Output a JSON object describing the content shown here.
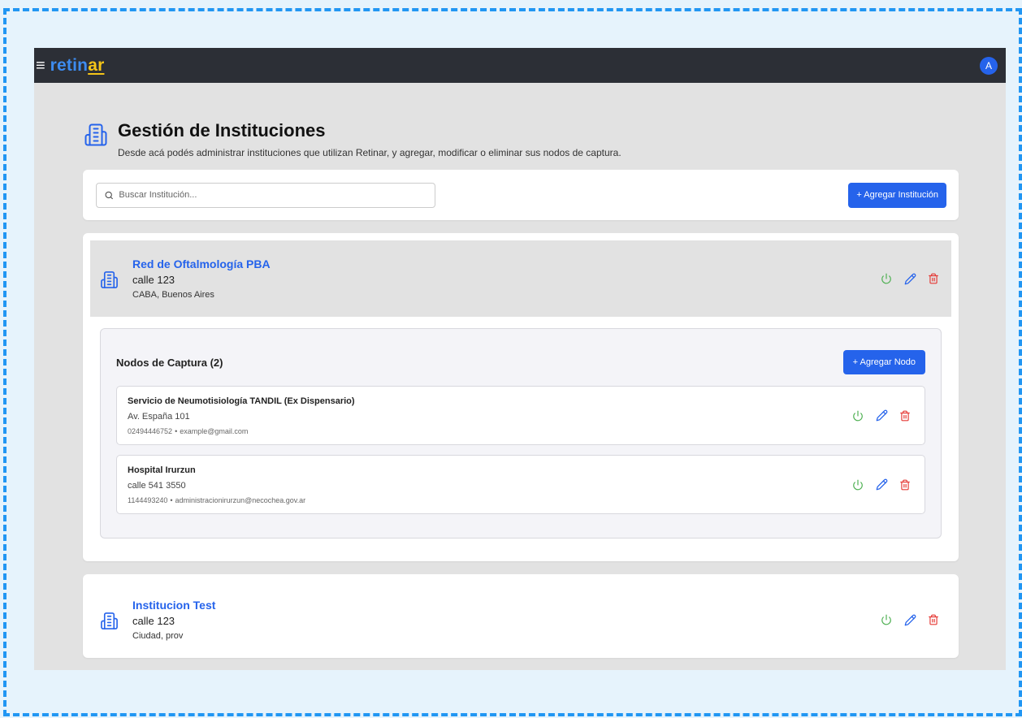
{
  "app": {
    "brand_part1": "retin",
    "brand_part2": "ar",
    "avatar_initial": "A"
  },
  "page": {
    "title": "Gestión de Instituciones",
    "subtitle": "Desde acá podés administrar instituciones que utilizan Retinar, y agregar, modificar o eliminar sus nodos de captura."
  },
  "search": {
    "placeholder": "Buscar Institución...",
    "add_button": "+ Agregar Institución"
  },
  "colors": {
    "accent": "#2563eb",
    "power": "#4caf50",
    "edit": "#2563eb",
    "delete": "#e53935",
    "topbar": "#2c2f36"
  },
  "institutions": [
    {
      "name": "Red de Oftalmología PBA",
      "street": "calle 123",
      "city": "CABA, Buenos Aires",
      "nodes": {
        "title": "Nodos de Captura (2)",
        "add_button": "+ Agregar Nodo",
        "items": [
          {
            "name": "Servicio de Neumotisiología TANDIL (Ex Dispensario)",
            "address": "Av. España 101",
            "phone": "02494446752",
            "separator": "•",
            "email": "example@gmail.com"
          },
          {
            "name": "Hospital Irurzun",
            "address": "calle 541 3550",
            "phone": "1144493240",
            "separator": "•",
            "email": "administracionirurzun@necochea.gov.ar"
          }
        ]
      }
    },
    {
      "name": "Institucion Test",
      "street": "calle 123",
      "city": "Ciudad, prov"
    }
  ],
  "icons": {
    "menu": "menu-icon",
    "building": "building-icon",
    "search": "search-icon",
    "power": "power-icon",
    "edit": "pencil-icon",
    "delete": "trash-icon"
  }
}
